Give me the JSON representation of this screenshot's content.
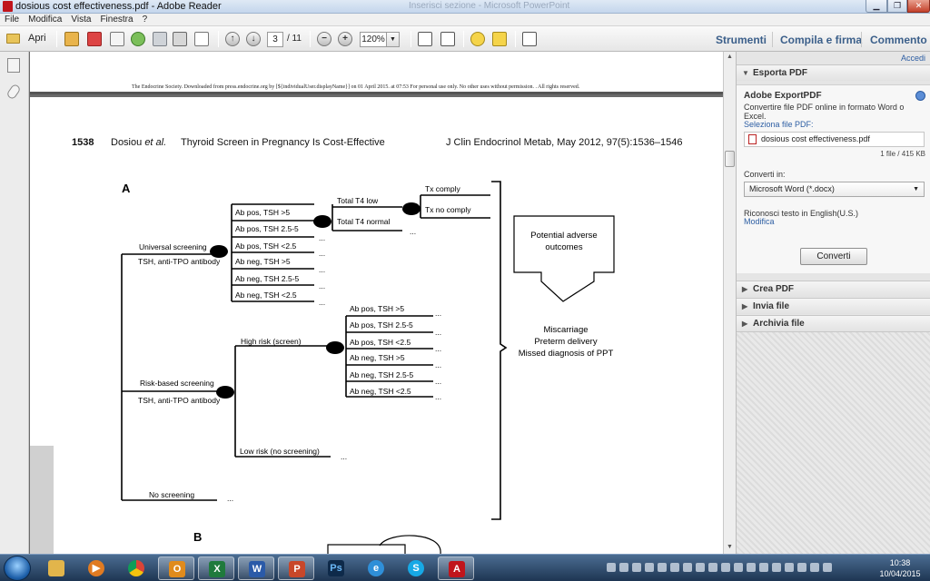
{
  "window": {
    "title": "dosious cost effectiveness.pdf - Adobe Reader",
    "ghost_title": "Inserisci sezione - Microsoft PowerPoint",
    "min_glyph": "▁",
    "max_glyph": "❐",
    "close_glyph": "✕"
  },
  "menu": [
    "File",
    "Modifica",
    "Vista",
    "Finestra",
    "?"
  ],
  "toolbar": {
    "open_label": "Apri",
    "current_page": "3",
    "total_pages": "/ 11",
    "zoom": "120%",
    "zoom_out_glyph": "−",
    "zoom_in_glyph": "+",
    "prev_glyph": "↑",
    "next_glyph": "↓",
    "dropdown_glyph": "▼",
    "right_tabs": [
      "Strumenti",
      "Compila e firma",
      "Commento"
    ]
  },
  "document": {
    "download_notice": "The Endocrine Society. Downloaded from press.endocrine.org by [${individualUser.displayName}] on 01 April 2015. at 07:53 For personal use only. No other uses without permission. . All rights reserved.",
    "running_head": {
      "page_number": "1538",
      "authors": "Dosiou",
      "authors_suffix": "et al.",
      "article_title": "Thyroid Screen in Pregnancy Is Cost-Effective",
      "journal": "J Clin Endocrinol Metab, May 2012, 97(5):1536–1546"
    },
    "figure": {
      "panel_a": "A",
      "panel_b": "B",
      "universal": "Universal screening",
      "universal_sub": "TSH, anti-TPO antibody",
      "risk_based": "Risk-based screening",
      "risk_based_sub": "TSH, anti-TPO antibody",
      "no_screening": "No screening",
      "high_risk": "High risk (screen)",
      "low_risk": "Low risk (no screening)",
      "universal_branches": [
        "Ab pos, TSH >5",
        "Ab pos, TSH 2.5-5",
        "Ab pos, TSH <2.5",
        "Ab neg, TSH >5",
        "Ab neg, TSH 2.5-5",
        "Ab neg, TSH <2.5"
      ],
      "high_risk_branches": [
        "Ab pos, TSH >5",
        "Ab pos, TSH 2.5-5",
        "Ab pos, TSH <2.5",
        "Ab neg, TSH >5",
        "Ab neg, TSH 2.5-5",
        "Ab neg, TSH <2.5"
      ],
      "total_t4_low": "Total T4 low",
      "total_t4_normal": "Total T4 normal",
      "tx_comply": "Tx comply",
      "tx_no_comply": "Tx no comply",
      "ellipsis": "...",
      "outcomes_box_line1": "Potential adverse",
      "outcomes_box_line2": "outcomes",
      "outcomes_list": [
        "Miscarriage",
        "Preterm delivery",
        "Missed diagnosis of PPT"
      ]
    }
  },
  "right_pane": {
    "sign_in": "Accedi",
    "export_header": "Esporta PDF",
    "export_title": "Adobe ExportPDF",
    "export_desc": "Convertire file PDF online in formato Word o Excel.",
    "select_file_label": "Seleziona file PDF:",
    "file_name": "dosious cost effectiveness.pdf",
    "file_count": "1 file / 415 KB",
    "convert_to_label": "Converti in:",
    "convert_to_value": "Microsoft Word (*.docx)",
    "ocr_label": "Riconosci testo in English(U.S.)",
    "ocr_modify": "Modifica",
    "convert_button": "Converti",
    "collapsed_panels": [
      "Crea PDF",
      "Invia file",
      "Archivia file"
    ],
    "expanded_glyph": "▼",
    "collapsed_glyph": "▶"
  },
  "taskbar": {
    "time": "10:38",
    "date": "10/04/2015"
  },
  "colors": {
    "link_blue": "#2d5ea3",
    "tab_blue": "#3b5f8a",
    "adobe_red": "#c0151c"
  }
}
